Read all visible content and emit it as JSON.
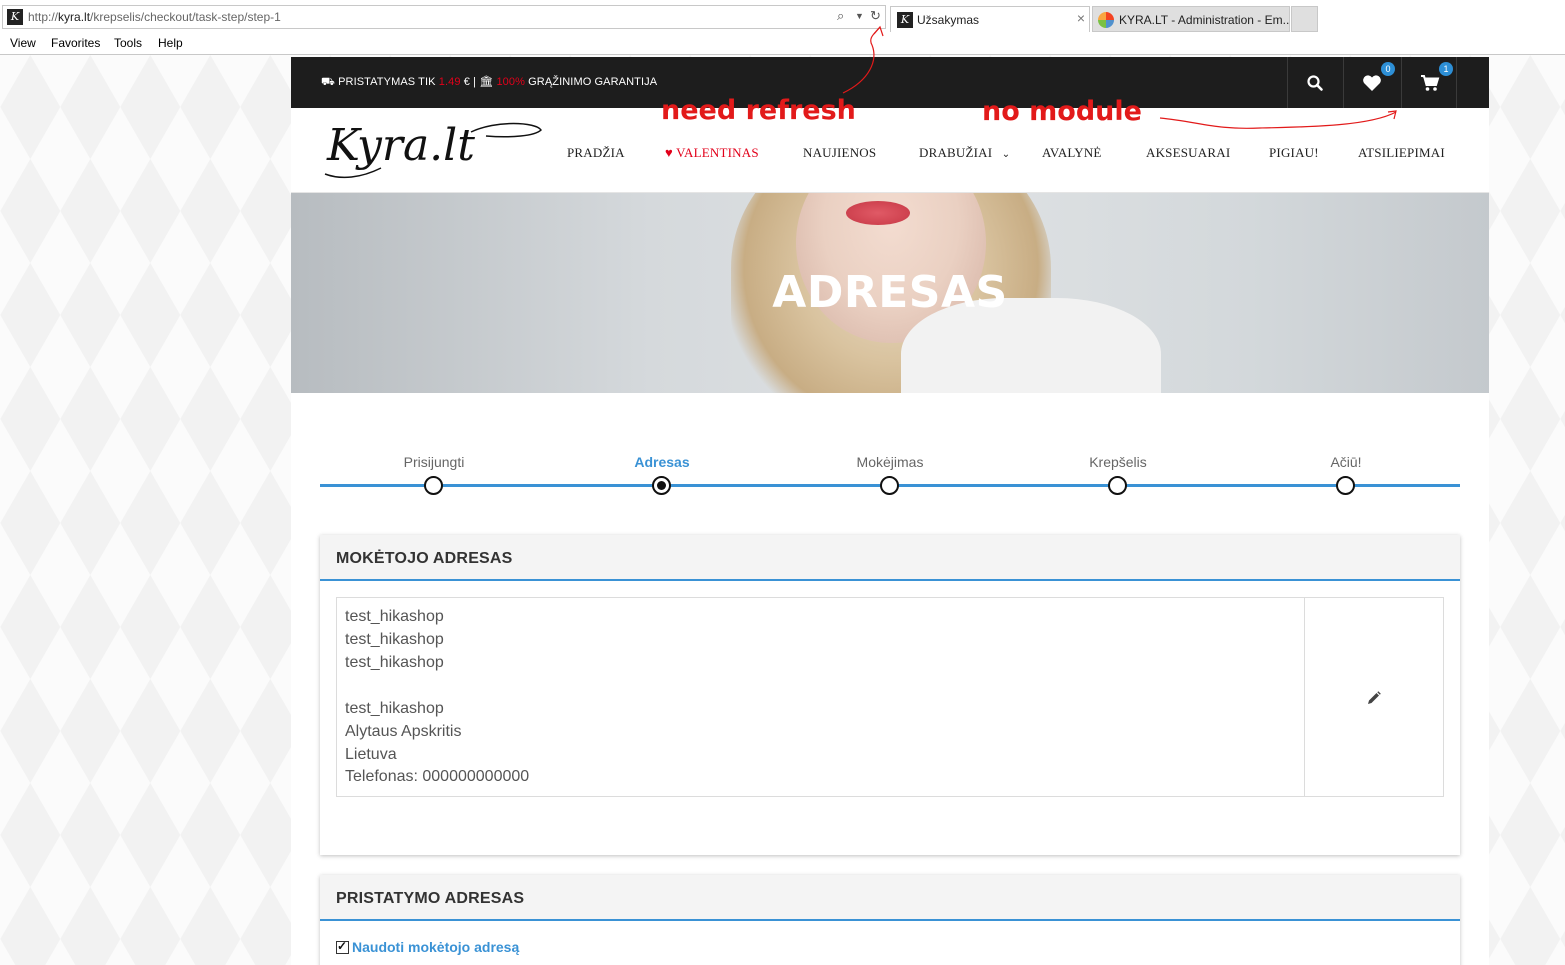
{
  "browser": {
    "url_prefix": "http://",
    "url_host": "kyra.lt",
    "url_path": "/krepselis/checkout/task-step/step-1",
    "tabs": [
      {
        "label": "Užsakymas",
        "active": true
      },
      {
        "label": "KYRA.LT - Administration - Em...",
        "active": false
      }
    ],
    "menu": [
      "View",
      "Favorites",
      "Tools",
      "Help"
    ]
  },
  "topbar": {
    "text_prefix": "PRISTATYMAS TIK ",
    "price": "1.49",
    "text_mid": " € | ",
    "percent": "100%",
    "text_suffix": " GRĄŽINIMO GARANTIJA",
    "wishlist_count": "0",
    "cart_count": "1",
    "accent_color": "#e2001a"
  },
  "logo": {
    "text": "Kyra.lt"
  },
  "nav": [
    "PRADŽIA",
    "VALENTINAS",
    "NAUJIENOS",
    "DRABUŽIAI",
    "AVALYNĖ",
    "AKSESUARAI",
    "PIGIAU!",
    "ATSILIEPIMAI"
  ],
  "hero": {
    "title": "ADRESAS"
  },
  "steps": [
    {
      "label": "Prisijungti",
      "active": false
    },
    {
      "label": "Adresas",
      "active": true
    },
    {
      "label": "Mokėjimas",
      "active": false
    },
    {
      "label": "Krepšelis",
      "active": false
    },
    {
      "label": "Ačiū!",
      "active": false
    }
  ],
  "billing": {
    "title": "MOKĖTOJO ADRESAS",
    "lines": [
      "test_hikashop",
      "test_hikashop",
      "test_hikashop",
      "",
      "test_hikashop",
      "Alytaus Apskritis",
      "Lietuva",
      "Telefonas: 000000000000"
    ]
  },
  "shipping": {
    "title": "PRISTATYMO ADRESAS",
    "use_billing_label": "Naudoti mokėtojo adresą",
    "use_billing_checked": true
  },
  "annotations": {
    "refresh": "need refresh",
    "module": "no module"
  },
  "colors": {
    "accent_blue": "#3a92d5",
    "annotation_red": "#e21a1a"
  }
}
